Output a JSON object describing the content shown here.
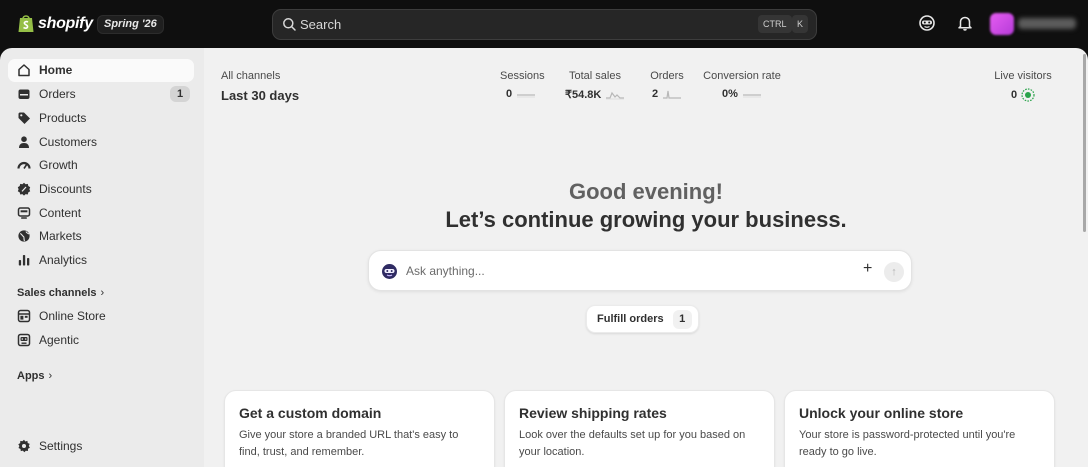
{
  "topbar": {
    "logo_text": "shopify",
    "edition": "Spring '26",
    "search_placeholder": "Search",
    "shortcut_ctrl": "CTRL",
    "shortcut_key": "K"
  },
  "sidebar": {
    "items": [
      {
        "label": "Home",
        "icon": "home-icon"
      },
      {
        "label": "Orders",
        "icon": "inbox-icon",
        "badge": "1"
      },
      {
        "label": "Products",
        "icon": "tag-icon"
      },
      {
        "label": "Customers",
        "icon": "person-icon"
      },
      {
        "label": "Growth",
        "icon": "gauge-icon"
      },
      {
        "label": "Discounts",
        "icon": "discount-icon"
      },
      {
        "label": "Content",
        "icon": "content-icon"
      },
      {
        "label": "Markets",
        "icon": "globe-icon"
      },
      {
        "label": "Analytics",
        "icon": "bar-chart-icon"
      }
    ],
    "sales_channels_heading": "Sales channels",
    "channels": [
      {
        "label": "Online Store",
        "icon": "store-icon"
      },
      {
        "label": "Agentic",
        "icon": "agentic-icon"
      }
    ],
    "apps_heading": "Apps",
    "settings_label": "Settings"
  },
  "metrics": {
    "channel": "All channels",
    "range": "Last 30 days",
    "items": [
      {
        "label": "Sessions",
        "value": "0"
      },
      {
        "label": "Total sales",
        "value": "₹54.8K"
      },
      {
        "label": "Orders",
        "value": "2"
      },
      {
        "label": "Conversion rate",
        "value": "0%"
      }
    ],
    "live_label": "Live visitors",
    "live_value": "0",
    "colors": {
      "live_indicator": "#29a34a"
    }
  },
  "greeting": {
    "line1": "Good evening!",
    "line2": "Let’s continue growing your business."
  },
  "ask": {
    "placeholder": "Ask anything..."
  },
  "chip": {
    "label": "Fulfill orders",
    "count": "1"
  },
  "cards": [
    {
      "title": "Get a custom domain",
      "body": "Give your store a branded URL that's easy to find, trust, and remember."
    },
    {
      "title": "Review shipping rates",
      "body": "Look over the defaults set up for you based on your location."
    },
    {
      "title": "Unlock your online store",
      "body": "Your store is password-protected until you're ready to go live."
    }
  ]
}
